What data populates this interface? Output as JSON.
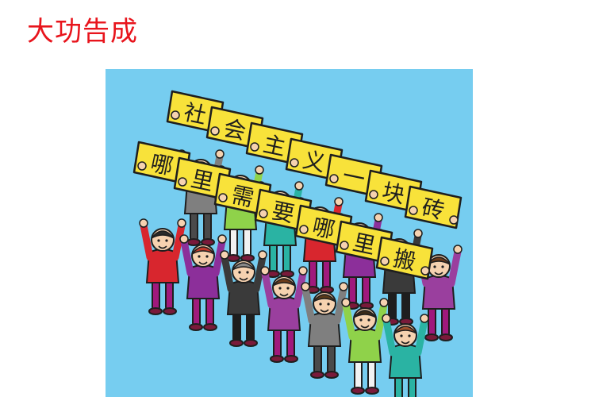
{
  "title": "大功告成",
  "colors": {
    "title": "#e8141c",
    "background": "#76cdf0",
    "sign": "#f8e23a",
    "outline": "#1e1e1e"
  },
  "signs": {
    "row1": [
      "社",
      "会",
      "主",
      "义",
      "一",
      "块",
      "砖"
    ],
    "row2": [
      "哪",
      "里",
      "需",
      "要",
      "哪",
      "里",
      "搬"
    ]
  }
}
